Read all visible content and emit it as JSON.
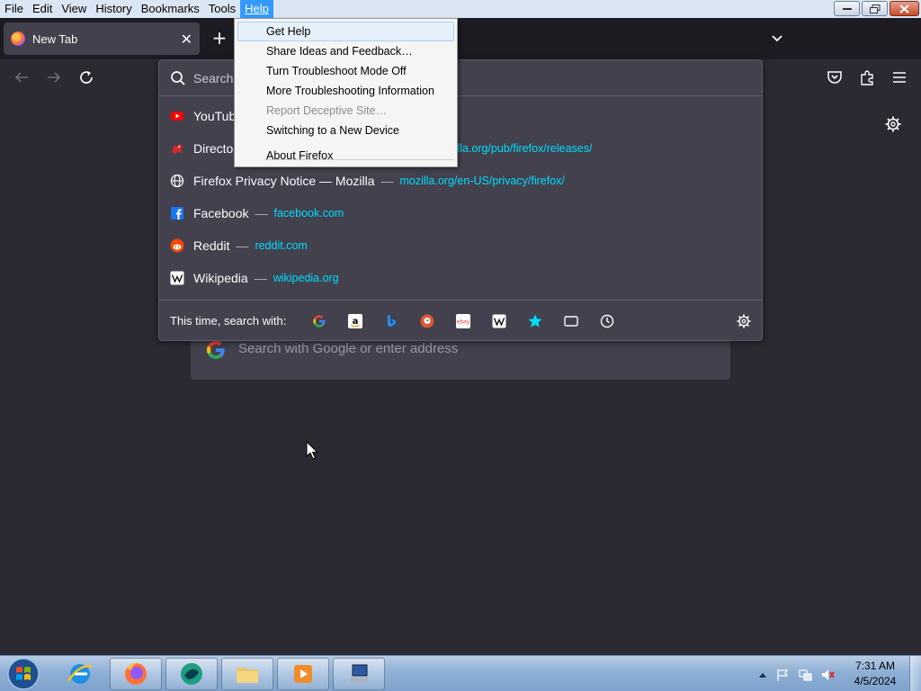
{
  "menubar": {
    "items": [
      "File",
      "Edit",
      "View",
      "History",
      "Bookmarks",
      "Tools",
      "Help"
    ],
    "active": "Help"
  },
  "tab": {
    "title": "New Tab"
  },
  "urlbar": {
    "input_text": "Search",
    "results": [
      {
        "title": "YouTube",
        "url": ""
      },
      {
        "title": "Directo",
        "url": "zilla.org/pub/firefox/releases/"
      },
      {
        "title": "Firefox Privacy Notice — Mozilla",
        "url": "mozilla.org/en-US/privacy/firefox/"
      },
      {
        "title": "Facebook",
        "url": "facebook.com"
      },
      {
        "title": "Reddit",
        "url": "reddit.com"
      },
      {
        "title": "Wikipedia",
        "url": "wikipedia.org"
      }
    ],
    "separator": "—",
    "oneoff_label": "This time, search with:",
    "engines": [
      "Google",
      "Amazon",
      "Bing",
      "DuckDuckGo",
      "eBay",
      "Wikipedia",
      "Bookmarks",
      "Tabs",
      "History"
    ]
  },
  "help_menu": {
    "items": [
      {
        "label": "Get Help",
        "enabled": true,
        "highlighted": true
      },
      {
        "label": "Share Ideas and Feedback…",
        "enabled": true
      },
      {
        "label": "Turn Troubleshoot Mode Off",
        "enabled": true
      },
      {
        "label": "More Troubleshooting Information",
        "enabled": true
      },
      {
        "label": "Report Deceptive Site…",
        "enabled": false
      },
      {
        "label": "Switching to a New Device",
        "enabled": true
      },
      {
        "label": "About Firefox",
        "enabled": true
      }
    ]
  },
  "content": {
    "search_placeholder": "Search with Google or enter address"
  },
  "taskbar": {
    "apps": [
      "Internet Explorer",
      "Firefox",
      "App",
      "Windows Explorer",
      "Media Player",
      "Network"
    ],
    "clock_time": "7:31 AM",
    "clock_date": "4/5/2024"
  },
  "colors": {
    "accent": "#00ddff",
    "menu_highlight": "#3399ff",
    "panel": "#42414d",
    "background": "#2b2a33"
  }
}
